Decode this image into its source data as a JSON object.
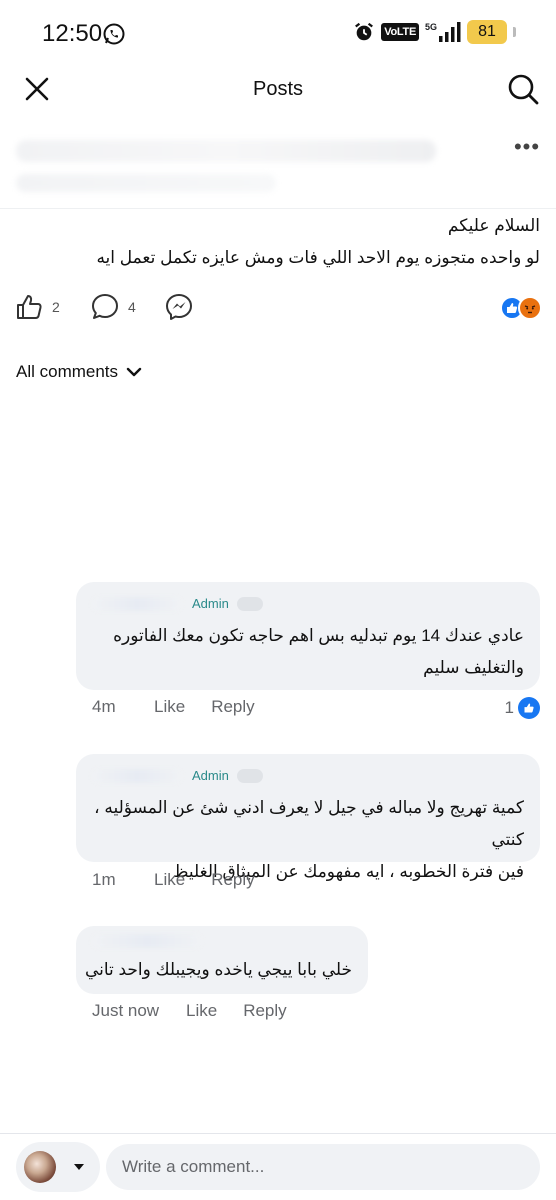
{
  "status_bar": {
    "time": "12:50",
    "volte": "VoLTE",
    "network": "5G",
    "battery": "81",
    "icons": [
      "whatsapp-icon",
      "alarm-icon",
      "signal-icon",
      "battery-icon"
    ]
  },
  "nav": {
    "title": "Posts",
    "close_icon": "close-icon",
    "search_icon": "search-icon"
  },
  "post": {
    "more": "•••",
    "text": [
      "السلام عليكم",
      "لو واحده متجوزه يوم الاحد اللي فات ومش عايزه تكمل تعمل ايه"
    ],
    "likes": "2",
    "comments": "4",
    "reaction_icons": [
      "like-reaction-icon",
      "angry-reaction-icon"
    ]
  },
  "comments_header": {
    "label": "All comments"
  },
  "comments": [
    {
      "admin": "Admin",
      "lines": [
        "عادي عندك 14 يوم تبدليه بس اهم حاجه تكون معك الفاتوره",
        "والتغليف سليم"
      ],
      "time": "4m",
      "like": "Like",
      "reply": "Reply",
      "like_count": "1"
    },
    {
      "admin": "Admin",
      "lines": [
        "كمية تهريج ولا مباله في جيل لا يعرف ادني شئ عن المسؤليه ، كنتي",
        "فين فترة الخطوبه ، ايه مفهومك عن الميثاق الغليظ"
      ],
      "time": "1m",
      "like": "Like",
      "reply": "Reply"
    },
    {
      "lines": [
        "خلي بابا ييجي ياخده ويجيبلك واحد تاني"
      ],
      "time": "Just now",
      "like": "Like",
      "reply": "Reply"
    }
  ],
  "composer": {
    "placeholder": "Write a comment..."
  },
  "colors": {
    "accent": "#1877f2",
    "bubble": "#f0f2f5",
    "admin": "#2a8a8a",
    "muted": "#65676b"
  }
}
